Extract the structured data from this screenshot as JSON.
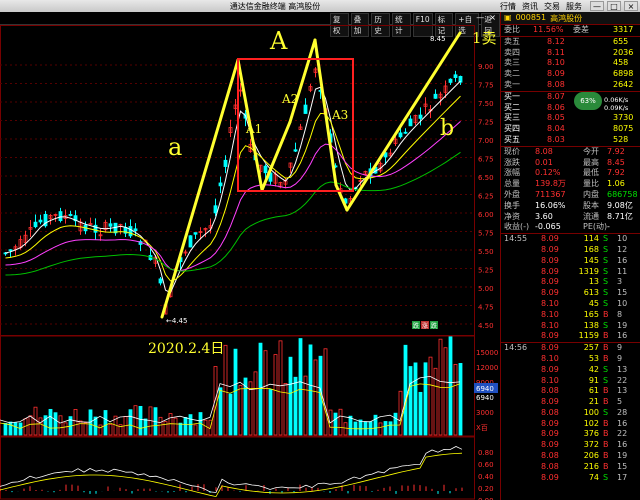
{
  "window": {
    "title": "通达信金融终端 高鸿股份",
    "menus": [
      "行情",
      "资讯",
      "交易",
      "服务"
    ],
    "controls": [
      "—",
      "□",
      "×"
    ]
  },
  "toolbar": {
    "buttons": [
      "复权",
      "叠加",
      "历史",
      "统计",
      "F10",
      "标记",
      "+自选",
      "返回"
    ],
    "win_controls": [
      "—",
      "×"
    ]
  },
  "chart": {
    "price_labels": [
      "9.00",
      "7.75",
      "7.50",
      "7.25",
      "7.00",
      "6.75",
      "6.50",
      "6.25",
      "6.00",
      "5.75",
      "5.50",
      "5.25",
      "5.00",
      "4.75",
      "4.50"
    ],
    "high_label": "8.45",
    "low_label": "4.45",
    "volume_labels": [
      "15000",
      "12000",
      "9000",
      "6940",
      "3000",
      "X百"
    ],
    "volume_highlight": "6940",
    "macd_labels": [
      "0.80",
      "0.60",
      "0.40",
      "0.20",
      "0.00"
    ],
    "annotations": {
      "a": "a",
      "A": "A",
      "A1": "A1",
      "A2": "A2",
      "A3": "A3",
      "b": "b",
      "sell": "1卖",
      "date": "2020.2.4日"
    },
    "markers": [
      "跌",
      "涨",
      "跌"
    ],
    "colors": {
      "up": "#ff3030",
      "down": "#00ffff",
      "ma_white": "#ffffff",
      "ma_yellow": "#ffff00",
      "ma_magenta": "#ff40ff",
      "ma_green": "#00c000",
      "annotation": "#ffff30",
      "box": "#ff2020"
    }
  },
  "panel": {
    "code": "000851",
    "name": "高鸿股份",
    "webi": {
      "label": "委比",
      "value": "11.56%",
      "label2": "委差",
      "value2": "3317"
    },
    "sells": [
      {
        "label": "卖五",
        "price": "8.12",
        "vol": "655"
      },
      {
        "label": "卖四",
        "price": "8.11",
        "vol": "2036"
      },
      {
        "label": "卖三",
        "price": "8.10",
        "vol": "458"
      },
      {
        "label": "卖二",
        "price": "8.09",
        "vol": "6898"
      },
      {
        "label": "卖一",
        "price": "8.08",
        "vol": "2642"
      }
    ],
    "buys": [
      {
        "label": "买一",
        "price": "8.07",
        "vol": ""
      },
      {
        "label": "买二",
        "price": "8.06",
        "vol": ""
      },
      {
        "label": "买三",
        "price": "8.05",
        "vol": "3730"
      },
      {
        "label": "买四",
        "price": "8.04",
        "vol": "8075"
      },
      {
        "label": "买五",
        "price": "8.03",
        "vol": "528"
      }
    ],
    "badge": "63%",
    "speed_up": "0.06K/s",
    "speed_down": "0.09K/s",
    "stats": [
      {
        "l1": "现价",
        "v1": "8.08",
        "l2": "今开",
        "v2": "7.92"
      },
      {
        "l1": "涨跌",
        "v1": "0.01",
        "l2": "最高",
        "v2": "8.45"
      },
      {
        "l1": "涨幅",
        "v1": "0.12%",
        "l2": "最低",
        "v2": "7.92"
      },
      {
        "l1": "总量",
        "v1": "139.8万",
        "l2": "量比",
        "v2": "1.06"
      },
      {
        "l1": "外盘",
        "v1": "711367",
        "l2": "内盘",
        "v2": "686758"
      },
      {
        "l1": "换手",
        "v1": "16.06%",
        "l2": "股本",
        "v2": "9.08亿"
      },
      {
        "l1": "净资",
        "v1": "3.60",
        "l2": "流通",
        "v2": "8.71亿"
      },
      {
        "l1": "收益(-)",
        "v1": "-0.065",
        "l2": "PE(动)",
        "v2": "-"
      }
    ],
    "ticks1": [
      {
        "t": "14:55",
        "p": "8.09",
        "v": "114",
        "f": "S",
        "n": "10"
      },
      {
        "t": "",
        "p": "8.09",
        "v": "168",
        "f": "S",
        "n": "12"
      },
      {
        "t": "",
        "p": "8.09",
        "v": "145",
        "f": "S",
        "n": "16"
      },
      {
        "t": "",
        "p": "8.09",
        "v": "1319",
        "f": "S",
        "n": "11"
      },
      {
        "t": "",
        "p": "8.09",
        "v": "13",
        "f": "S",
        "n": "3"
      },
      {
        "t": "",
        "p": "8.09",
        "v": "613",
        "f": "S",
        "n": "15"
      },
      {
        "t": "",
        "p": "8.10",
        "v": "45",
        "f": "S",
        "n": "10"
      },
      {
        "t": "",
        "p": "8.10",
        "v": "165",
        "f": "B",
        "n": "8"
      },
      {
        "t": "",
        "p": "8.10",
        "v": "138",
        "f": "S",
        "n": "19"
      },
      {
        "t": "",
        "p": "8.09",
        "v": "1159",
        "f": "B",
        "n": "16"
      }
    ],
    "ticks2": [
      {
        "t": "14:56",
        "p": "8.09",
        "v": "257",
        "f": "B",
        "n": "9"
      },
      {
        "t": "",
        "p": "8.10",
        "v": "53",
        "f": "B",
        "n": "9"
      },
      {
        "t": "",
        "p": "8.09",
        "v": "42",
        "f": "S",
        "n": "13"
      },
      {
        "t": "",
        "p": "8.10",
        "v": "91",
        "f": "S",
        "n": "22"
      },
      {
        "t": "",
        "p": "8.08",
        "v": "61",
        "f": "B",
        "n": "13"
      },
      {
        "t": "",
        "p": "8.09",
        "v": "21",
        "f": "B",
        "n": "5"
      },
      {
        "t": "",
        "p": "8.08",
        "v": "100",
        "f": "S",
        "n": "28"
      },
      {
        "t": "",
        "p": "8.09",
        "v": "102",
        "f": "B",
        "n": "16"
      },
      {
        "t": "",
        "p": "8.09",
        "v": "376",
        "f": "B",
        "n": "22"
      },
      {
        "t": "",
        "p": "8.09",
        "v": "372",
        "f": "B",
        "n": "16"
      },
      {
        "t": "",
        "p": "8.08",
        "v": "206",
        "f": "B",
        "n": "19"
      },
      {
        "t": "",
        "p": "8.08",
        "v": "216",
        "f": "B",
        "n": "15"
      },
      {
        "t": "",
        "p": "8.09",
        "v": "74",
        "f": "S",
        "n": "17"
      }
    ]
  }
}
